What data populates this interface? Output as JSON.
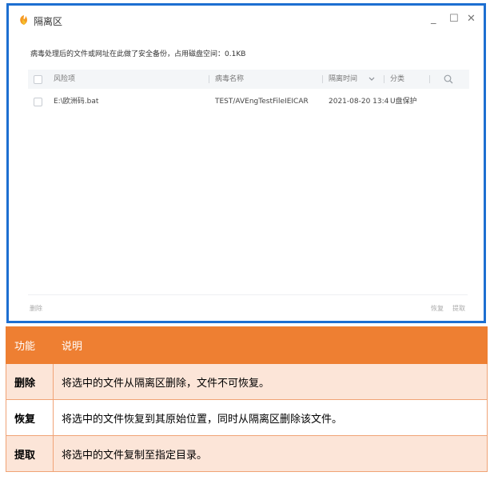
{
  "window": {
    "title": "隔离区",
    "controls": {
      "minimize": "_",
      "maximize": "☐",
      "close": "✕"
    }
  },
  "info_text": "病毒处理后的文件或网址在此做了安全备份，占用磁盘空间：0.1KB",
  "table": {
    "columns": [
      "风险项",
      "病毒名称",
      "隔离时间",
      "分类"
    ],
    "rows": [
      {
        "path": "E:\\欧洲码.bat",
        "virus": "TEST/AVEngTestFileIEICAR",
        "time": "2021-08-20 13:4",
        "category": "U盘保护"
      }
    ]
  },
  "footer": {
    "delete": "删除",
    "restore": "恢复",
    "extract": "提取"
  },
  "explain": {
    "header": [
      "功能",
      "说明"
    ],
    "rows": [
      {
        "name": "删除",
        "desc": "将选中的文件从隔离区删除，文件不可恢复。"
      },
      {
        "name": "恢复",
        "desc": "将选中的文件恢复到其原始位置，同时从隔离区删除该文件。"
      },
      {
        "name": "提取",
        "desc": "将选中的文件复制至指定目录。"
      }
    ]
  },
  "colors": {
    "window_border": "#1d6fd1",
    "table_header": "#ee7f32",
    "row_alt": "#fce5d8"
  }
}
